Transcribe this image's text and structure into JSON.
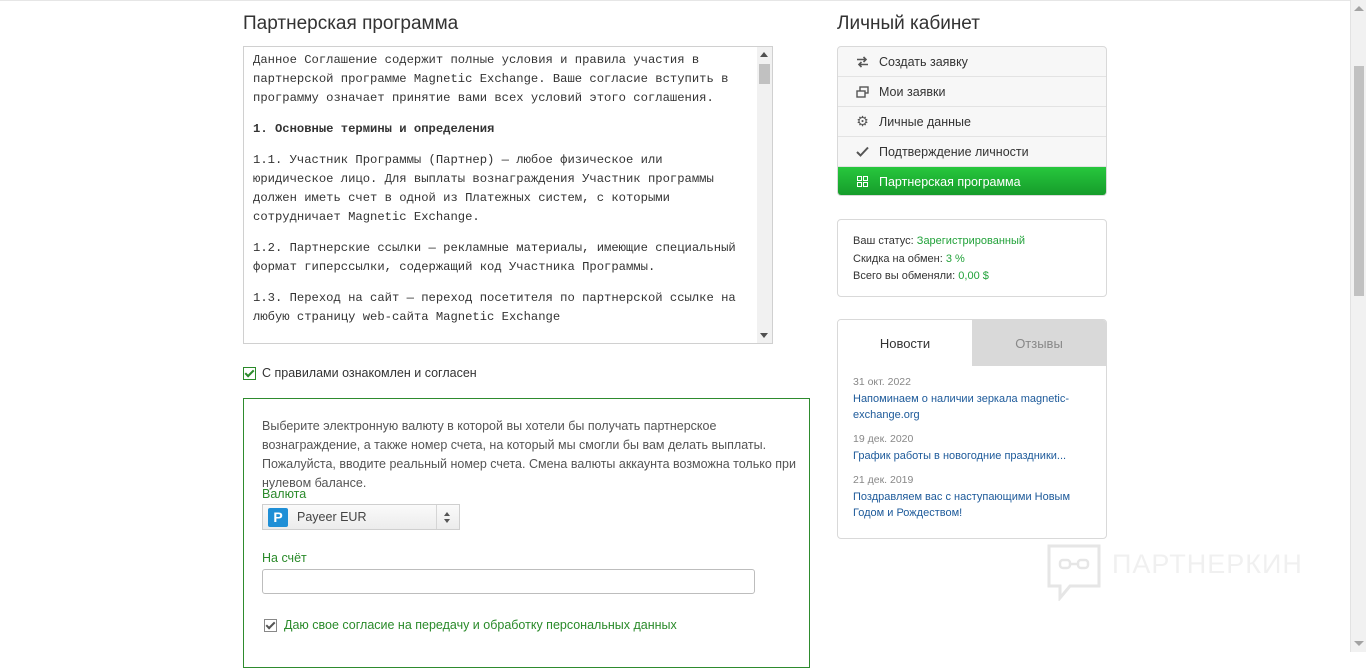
{
  "main": {
    "title": "Партнерская программа",
    "terms": [
      {
        "kind": "p",
        "text": "Данное Соглашение содержит полные условия и правила участия в партнерской программе Magnetic Exchange. Ваше согласие вступить в программу означает принятие вами всех условий этого соглашения."
      },
      {
        "kind": "h",
        "text": "1. Основные термины и определения"
      },
      {
        "kind": "p",
        "text": "1.1. Участник Программы (Партнер) — любое физическое или юридическое лицо. Для выплаты вознаграждения Участник программы должен иметь счет в одной из Платежных систем, с которыми сотрудничает Magnetic Exchange."
      },
      {
        "kind": "p",
        "text": "1.2. Партнерские ссылки — рекламные материалы, имеющие специальный формат гиперссылки, содержащий код Участника Программы."
      },
      {
        "kind": "p",
        "text": "1.3. Переход на сайт — переход посетителя по партнерской ссылке на любую страницу web-сайта Magnetic Exchange"
      }
    ],
    "agree_label": "С правилами ознакомлен и согласен",
    "form": {
      "description": "Выберите электронную валюту в которой вы хотели бы получать партнерское вознаграждение, а также номер счета, на который мы смогли бы вам делать выплаты. Пожалуйста, вводите реальный номер счета. Смена валюты аккаунта возможна только при нулевом балансе.",
      "currency_label": "Валюта",
      "currency_value": "Payeer EUR",
      "account_label": "На счёт",
      "account_value": "",
      "consent_label": "Даю свое согласие на передачу и обработку персональных данных"
    }
  },
  "sidebar": {
    "title": "Личный кабинет",
    "menu": [
      {
        "label": "Создать заявку",
        "icon": "exchange-arrows-icon"
      },
      {
        "label": "Мои заявки",
        "icon": "windows-icon"
      },
      {
        "label": "Личные данные",
        "icon": "gear-icon"
      },
      {
        "label": "Подтверждение личности",
        "icon": "checkmark-icon"
      },
      {
        "label": "Партнерская программа",
        "icon": "grid-icon"
      }
    ],
    "status": {
      "status_label": "Ваш статус:",
      "status_value": "Зарегистрированный",
      "discount_label": "Скидка на обмен:",
      "discount_value": "3 %",
      "total_label": "Всего вы обменяли:",
      "total_value": "0,00 $"
    },
    "news": {
      "tab_news": "Новости",
      "tab_reviews": "Отзывы",
      "items": [
        {
          "date": "31 окт. 2022",
          "title": "Напоминаем о наличии зеркала magnetic-exchange.org"
        },
        {
          "date": "19 дек. 2020",
          "title": "График работы в новогодние праздники..."
        },
        {
          "date": "21 дек. 2019",
          "title": "Поздравляем вас с наступающими Новым Годом и Рождеством!"
        }
      ]
    }
  },
  "watermark": "ПАРТНЕРКИН",
  "colors": {
    "accent_green": "#1fb534",
    "link_blue": "#1d5a9a",
    "form_border": "#2e8b2e"
  }
}
